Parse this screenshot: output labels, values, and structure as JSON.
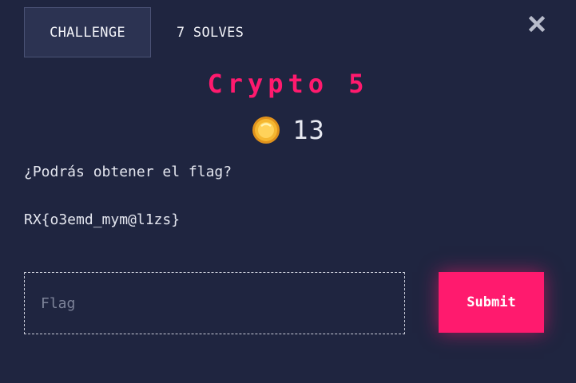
{
  "tabs": {
    "challenge": "CHALLENGE",
    "solves": "7 SOLVES"
  },
  "challenge": {
    "title": "Crypto 5",
    "points": "13",
    "question": "¿Podrás obtener el flag?",
    "ciphertext": "RX{o3emd_mym@l1zs}"
  },
  "form": {
    "placeholder": "Flag",
    "value": "",
    "submit_label": "Submit"
  },
  "icons": {
    "close": "close-icon",
    "coin": "coin-icon"
  },
  "colors": {
    "background": "#1f2540",
    "accent": "#ff1a6e",
    "coin": "#f5b731"
  }
}
